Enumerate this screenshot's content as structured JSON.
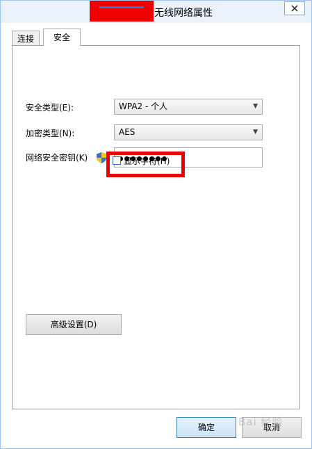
{
  "window": {
    "title": "无线网络属性"
  },
  "tabs": [
    {
      "label": "连接"
    },
    {
      "label": "安全"
    }
  ],
  "security": {
    "type_label": "安全类型(E):",
    "type_value": "WPA2 - 个人",
    "encryption_label": "加密类型(N):",
    "encryption_value": "AES",
    "key_label": "网络安全密钥(K)",
    "key_masked_length": 8,
    "show_chars_label": "显示字符(H)",
    "show_chars_checked": false
  },
  "buttons": {
    "advanced": "高级设置(D)",
    "ok": "确定",
    "cancel": "取消"
  },
  "watermark": {
    "text": "Bai 经验"
  },
  "colors": {
    "annotation_red": "#ee0000",
    "title_bg": "#eaf3fc"
  }
}
